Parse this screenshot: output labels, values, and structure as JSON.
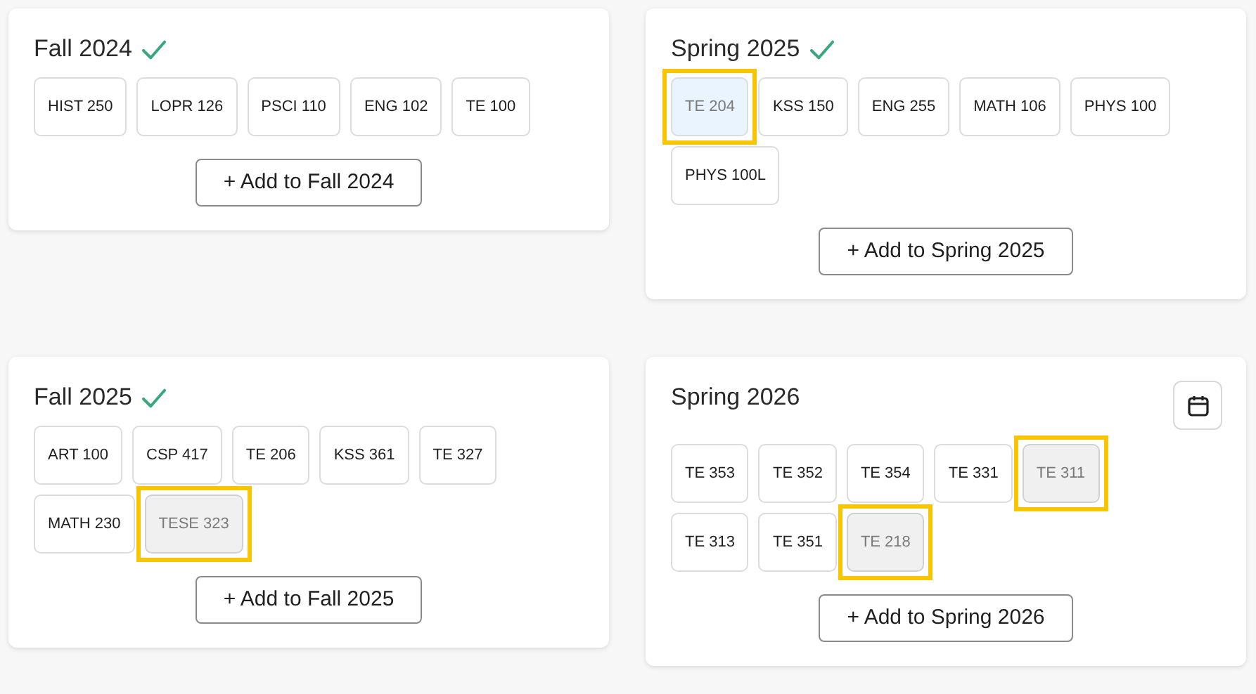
{
  "terms": [
    {
      "title": "Fall 2024",
      "complete": true,
      "calendar_button": false,
      "courses": [
        {
          "code": "HIST 250",
          "selected": false,
          "disabled": false,
          "highlighted": false
        },
        {
          "code": "LOPR 126",
          "selected": false,
          "disabled": false,
          "highlighted": false
        },
        {
          "code": "PSCI 110",
          "selected": false,
          "disabled": false,
          "highlighted": false
        },
        {
          "code": "ENG 102",
          "selected": false,
          "disabled": false,
          "highlighted": false
        },
        {
          "code": "TE 100",
          "selected": false,
          "disabled": false,
          "highlighted": false
        }
      ],
      "add_button": "+ Add to Fall 2024"
    },
    {
      "title": "Spring 2025",
      "complete": true,
      "calendar_button": false,
      "courses": [
        {
          "code": "TE 204",
          "selected": true,
          "disabled": false,
          "highlighted": true
        },
        {
          "code": "KSS 150",
          "selected": false,
          "disabled": false,
          "highlighted": false
        },
        {
          "code": "ENG 255",
          "selected": false,
          "disabled": false,
          "highlighted": false
        },
        {
          "code": "MATH 106",
          "selected": false,
          "disabled": false,
          "highlighted": false
        },
        {
          "code": "PHYS 100",
          "selected": false,
          "disabled": false,
          "highlighted": false
        },
        {
          "code": "PHYS 100L",
          "selected": false,
          "disabled": false,
          "highlighted": false
        }
      ],
      "add_button": "+ Add to Spring 2025"
    },
    {
      "title": "Fall 2025",
      "complete": true,
      "calendar_button": false,
      "courses": [
        {
          "code": "ART 100",
          "selected": false,
          "disabled": false,
          "highlighted": false
        },
        {
          "code": "CSP 417",
          "selected": false,
          "disabled": false,
          "highlighted": false
        },
        {
          "code": "TE 206",
          "selected": false,
          "disabled": false,
          "highlighted": false
        },
        {
          "code": "KSS 361",
          "selected": false,
          "disabled": false,
          "highlighted": false
        },
        {
          "code": "TE 327",
          "selected": false,
          "disabled": false,
          "highlighted": false
        },
        {
          "code": "MATH 230",
          "selected": false,
          "disabled": false,
          "highlighted": false
        },
        {
          "code": "TESE 323",
          "selected": false,
          "disabled": true,
          "highlighted": true
        }
      ],
      "add_button": "+ Add to Fall 2025"
    },
    {
      "title": "Spring 2026",
      "complete": false,
      "calendar_button": true,
      "courses": [
        {
          "code": "TE 353",
          "selected": false,
          "disabled": false,
          "highlighted": false
        },
        {
          "code": "TE 352",
          "selected": false,
          "disabled": false,
          "highlighted": false
        },
        {
          "code": "TE 354",
          "selected": false,
          "disabled": false,
          "highlighted": false
        },
        {
          "code": "TE 331",
          "selected": false,
          "disabled": false,
          "highlighted": false
        },
        {
          "code": "TE 311",
          "selected": false,
          "disabled": true,
          "highlighted": true
        },
        {
          "code": "TE 313",
          "selected": false,
          "disabled": false,
          "highlighted": false
        },
        {
          "code": "TE 351",
          "selected": false,
          "disabled": false,
          "highlighted": false
        },
        {
          "code": "TE 218",
          "selected": false,
          "disabled": true,
          "highlighted": true
        }
      ],
      "add_button": "+ Add to Spring 2026"
    }
  ]
}
